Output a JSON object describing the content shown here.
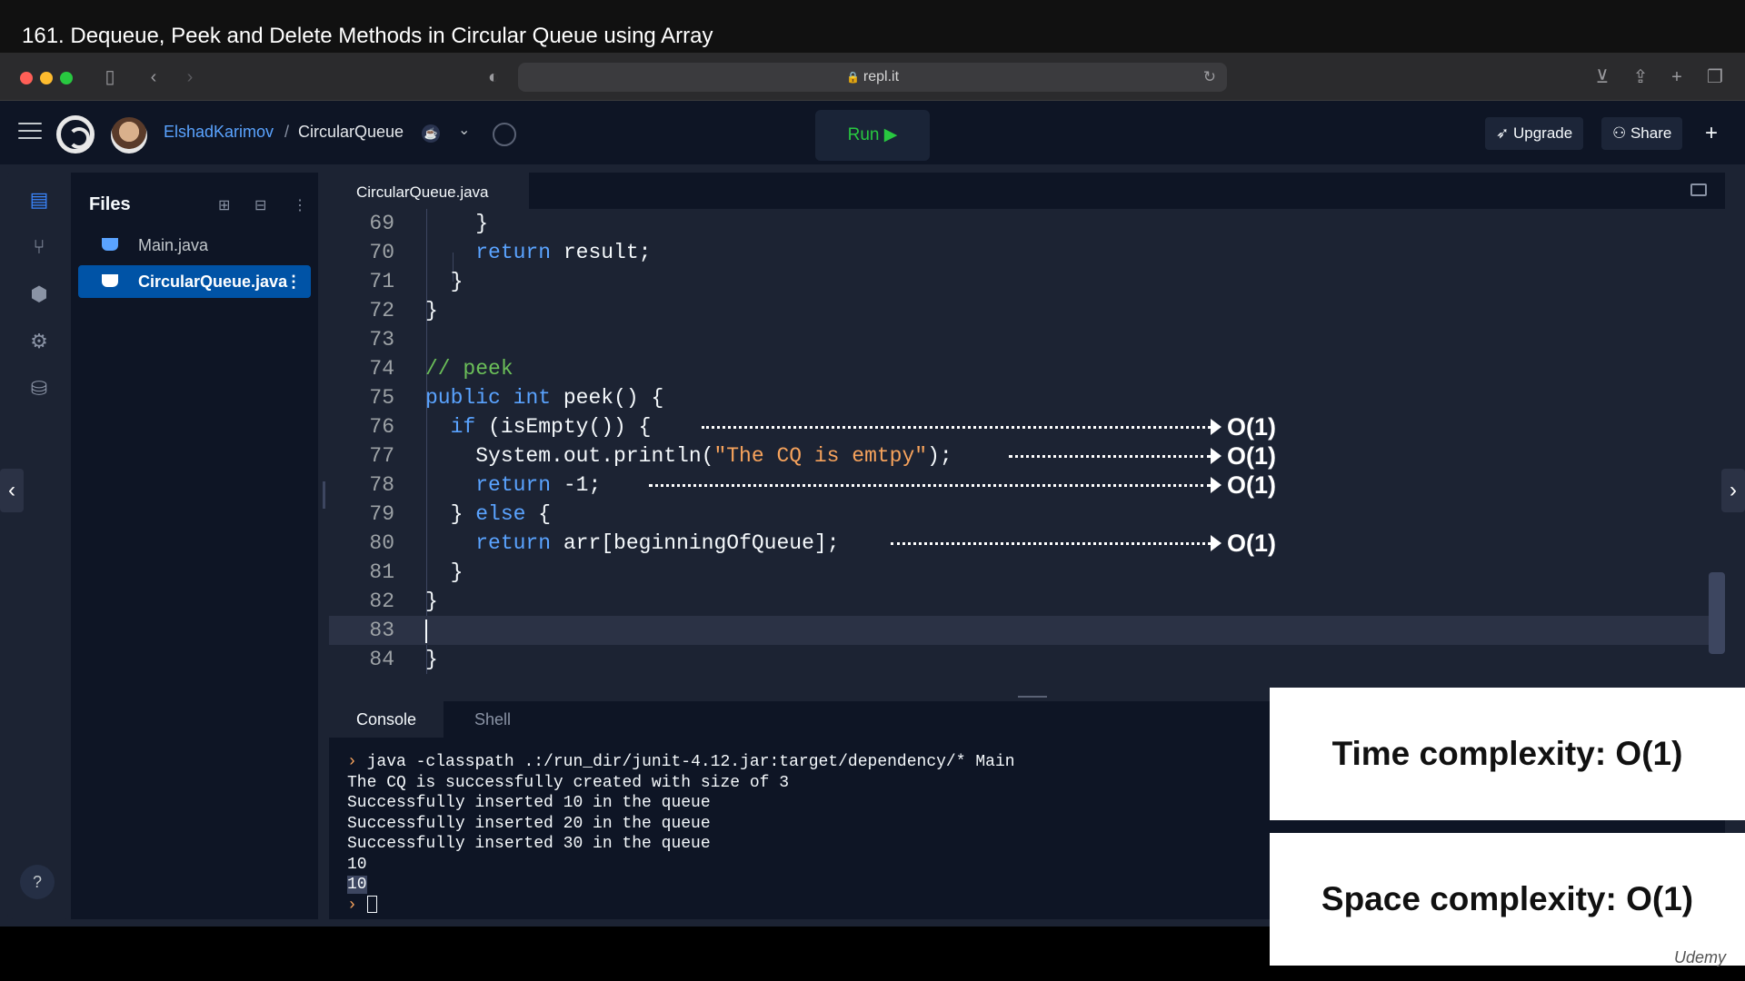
{
  "video_title": "161. Dequeue, Peek and Delete Methods in Circular Queue using Array",
  "browser": {
    "url": "repl.it",
    "icons": [
      "sidebar-icon",
      "back-icon",
      "forward-icon",
      "shield-icon",
      "lock-icon",
      "reload-icon",
      "download-icon",
      "share-icon",
      "new-tab-icon",
      "tabs-icon"
    ]
  },
  "header": {
    "user": "ElshadKarimov",
    "separator": "/",
    "project": "CircularQueue",
    "run_label": "Run ▶",
    "upgrade_label": "Upgrade",
    "share_label": "Share",
    "plus": "+"
  },
  "files_panel": {
    "title": "Files",
    "items": [
      {
        "label": "Main.java",
        "selected": false
      },
      {
        "label": "CircularQueue.java",
        "selected": true
      }
    ]
  },
  "editor": {
    "tab": "CircularQueue.java",
    "current_line": "83",
    "lines": [
      {
        "no": "69",
        "text": "    }"
      },
      {
        "no": "70",
        "text": "    return result;"
      },
      {
        "no": "71",
        "text": "  }"
      },
      {
        "no": "72",
        "text": "}"
      },
      {
        "no": "73",
        "text": ""
      },
      {
        "no": "74",
        "text": "// peek"
      },
      {
        "no": "75",
        "text": "public int peek() {"
      },
      {
        "no": "76",
        "text": "  if (isEmpty()) {"
      },
      {
        "no": "77",
        "text": "    System.out.println(\"The CQ is emtpy\");"
      },
      {
        "no": "78",
        "text": "    return -1;"
      },
      {
        "no": "79",
        "text": "  } else {"
      },
      {
        "no": "80",
        "text": "    return arr[beginningOfQueue];"
      },
      {
        "no": "81",
        "text": "  }"
      },
      {
        "no": "82",
        "text": "}"
      },
      {
        "no": "83",
        "text": ""
      },
      {
        "no": "84",
        "text": "}"
      }
    ],
    "annotations": [
      "O(1)",
      "O(1)",
      "O(1)",
      "O(1)"
    ]
  },
  "console": {
    "tabs": [
      "Console",
      "Shell"
    ],
    "prompt": "›",
    "command": "java -classpath .:/run_dir/junit-4.12.jar:target/dependency/* Main",
    "output": [
      "The CQ is successfully created with size of 3",
      "Successfully inserted 10 in the queue",
      "Successfully inserted 20 in the queue",
      "Successfully inserted 30 in the queue",
      "10",
      "10"
    ]
  },
  "overlay": {
    "time": "Time complexity: O(1)",
    "space": "Space complexity: O(1)"
  },
  "watermark": "Udemy",
  "colors": {
    "run": "#28c840",
    "keyword": "#5aa3ff",
    "string": "#f7a35c",
    "comment": "#6bbf59",
    "selected_file": "#0053a6"
  }
}
